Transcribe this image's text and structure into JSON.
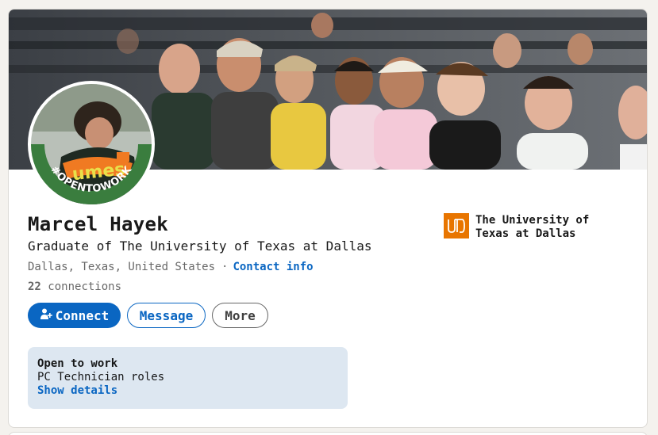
{
  "profile": {
    "name": "Marcel Hayek",
    "headline": "Graduate of The University of Texas at Dallas",
    "location": "Dallas, Texas, United States",
    "separator": "·",
    "contact_info": "Contact info",
    "connections_count": "22",
    "connections_label": "connections",
    "open_to_work_badge": "#OPENTOWORK",
    "avatar_shirt_text": "umes"
  },
  "actions": {
    "connect": "Connect",
    "message": "Message",
    "more": "More"
  },
  "open_to_work": {
    "title": "Open to work",
    "roles": "PC Technician roles",
    "show_details": "Show details"
  },
  "education": {
    "school": "The University of Texas at Dallas"
  },
  "colors": {
    "brand_blue": "#0a66c2",
    "open_to_work_green": "#3a7d3e",
    "utd_orange": "#e87500",
    "open_to_work_bg": "#dde7f1"
  },
  "icons": {
    "connect": "add-person-icon",
    "school_logo": "utd-logo-icon"
  }
}
